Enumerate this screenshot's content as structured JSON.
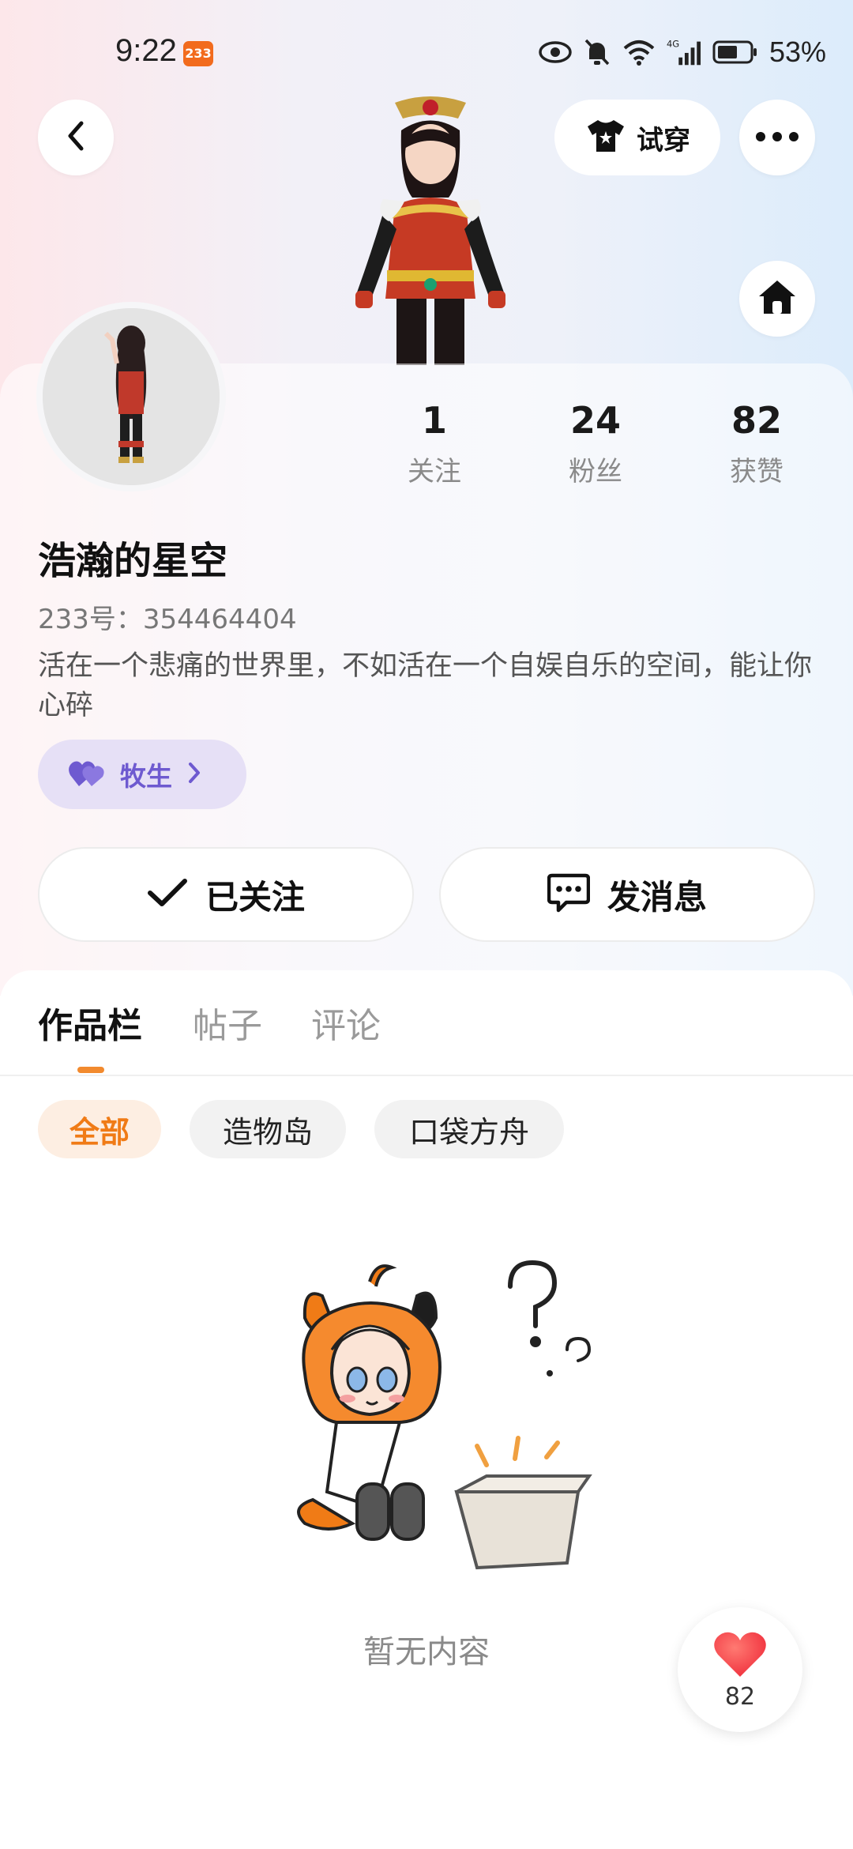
{
  "status_bar": {
    "time": "9:22",
    "app_badge": "233",
    "battery": "53%",
    "icons": [
      "eye-icon",
      "bell-mute-icon",
      "wifi-icon",
      "signal-4g-icon",
      "battery-icon"
    ]
  },
  "header": {
    "back_icon": "chevron-left-icon",
    "tryon_label": "试穿",
    "more_icon": "more-dots-icon",
    "home_icon": "home-icon"
  },
  "profile": {
    "stats": [
      {
        "value": "1",
        "label": "关注"
      },
      {
        "value": "24",
        "label": "粉丝"
      },
      {
        "value": "82",
        "label": "获赞"
      }
    ],
    "username": "浩瀚的星空",
    "uid": "233号：354464404",
    "bio": "活在一个悲痛的世界里，不如活在一个自娱自乐的空间，能让你心碎",
    "tag_label": "牧生",
    "follow_label": "已关注",
    "message_label": "发消息"
  },
  "tabs": [
    {
      "label": "作品栏",
      "active": true
    },
    {
      "label": "帖子",
      "active": false
    },
    {
      "label": "评论",
      "active": false
    }
  ],
  "filters": [
    {
      "label": "全部",
      "active": true
    },
    {
      "label": "造物岛",
      "active": false
    },
    {
      "label": "口袋方舟",
      "active": false
    }
  ],
  "empty_state": {
    "text": "暂无内容"
  },
  "like_fab": {
    "count": "82"
  },
  "colors": {
    "accent": "#f07b16",
    "tag_bg": "#e6e0f6",
    "tag_text": "#6e5ad0",
    "heart": "#f4484f"
  }
}
